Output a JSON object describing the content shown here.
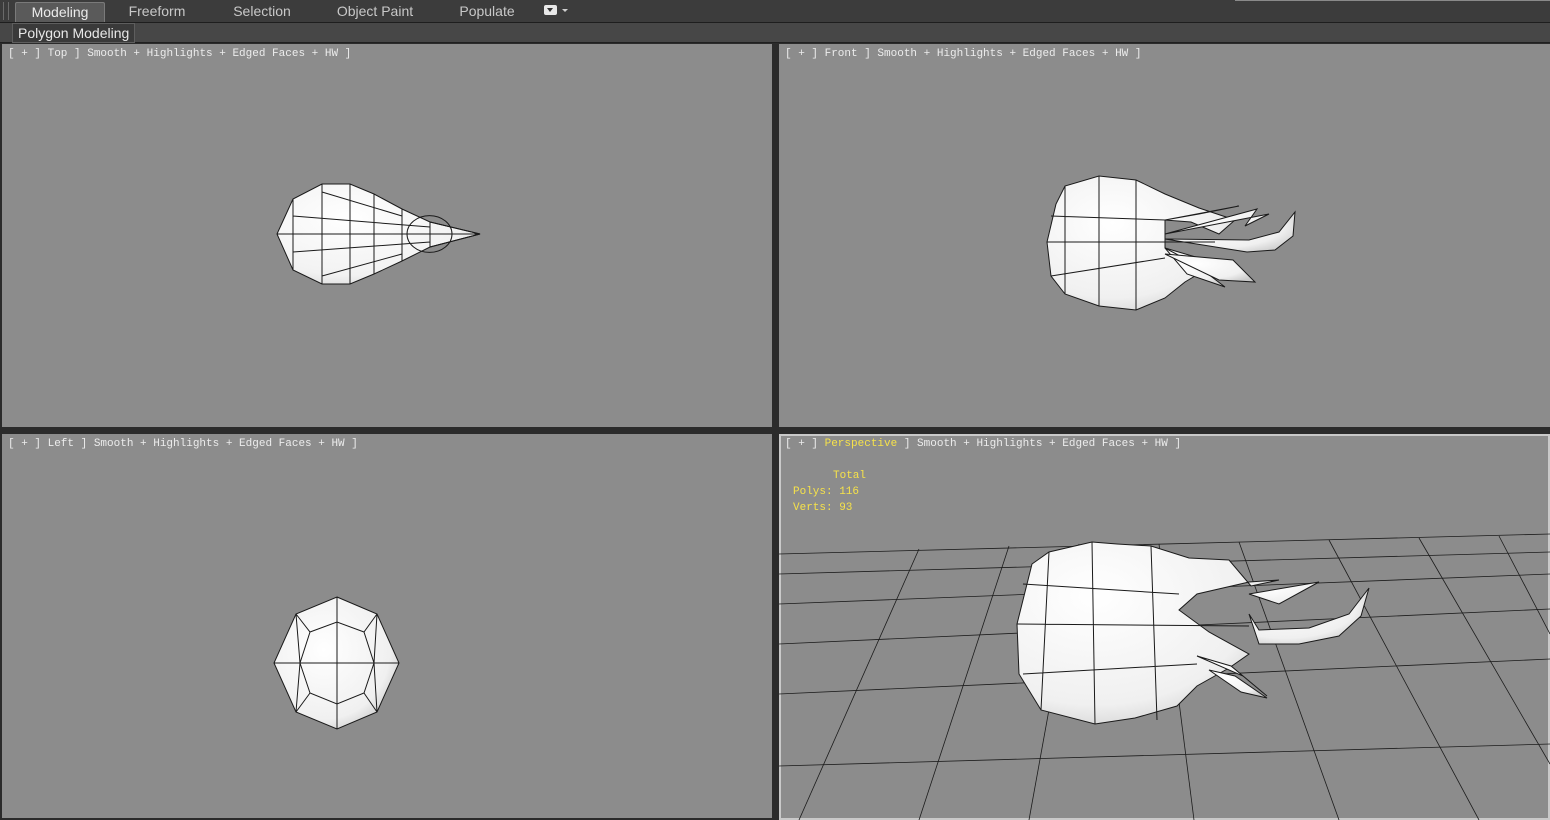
{
  "ribbon": {
    "tabs": [
      {
        "label": "Modeling",
        "active": true
      },
      {
        "label": "Freeform",
        "active": false
      },
      {
        "label": "Selection",
        "active": false
      },
      {
        "label": "Object Paint",
        "active": false
      },
      {
        "label": "Populate",
        "active": false
      }
    ],
    "panel_button": "Polygon Modeling",
    "dropdown_icon": "dropdown-menu-icon"
  },
  "viewports": {
    "top": {
      "open": "[ + ] ",
      "name": "Top",
      "rest": " ] Smooth + Highlights + Edged Faces + HW ]"
    },
    "front": {
      "open": "[ + ] ",
      "name": "Front",
      "rest": " ] Smooth + Highlights + Edged Faces + HW ]"
    },
    "left": {
      "open": "[ + ] ",
      "name": "Left",
      "rest": " ] Smooth + Highlights + Edged Faces + HW ]"
    },
    "perspective": {
      "open": "[ + ] ",
      "name": "Perspective",
      "rest": " ] Smooth + Highlights + Edged Faces + HW ]"
    }
  },
  "stats": {
    "total_label": "Total",
    "polys": "Polys: 116",
    "verts": "Verts: 93"
  },
  "colors": {
    "viewport_bg": "#8c8c8c",
    "stats_text": "#f6e24a",
    "label_text": "#ececec",
    "mesh_fill": "#f5f5f5",
    "mesh_edge": "#1a1a1a"
  }
}
